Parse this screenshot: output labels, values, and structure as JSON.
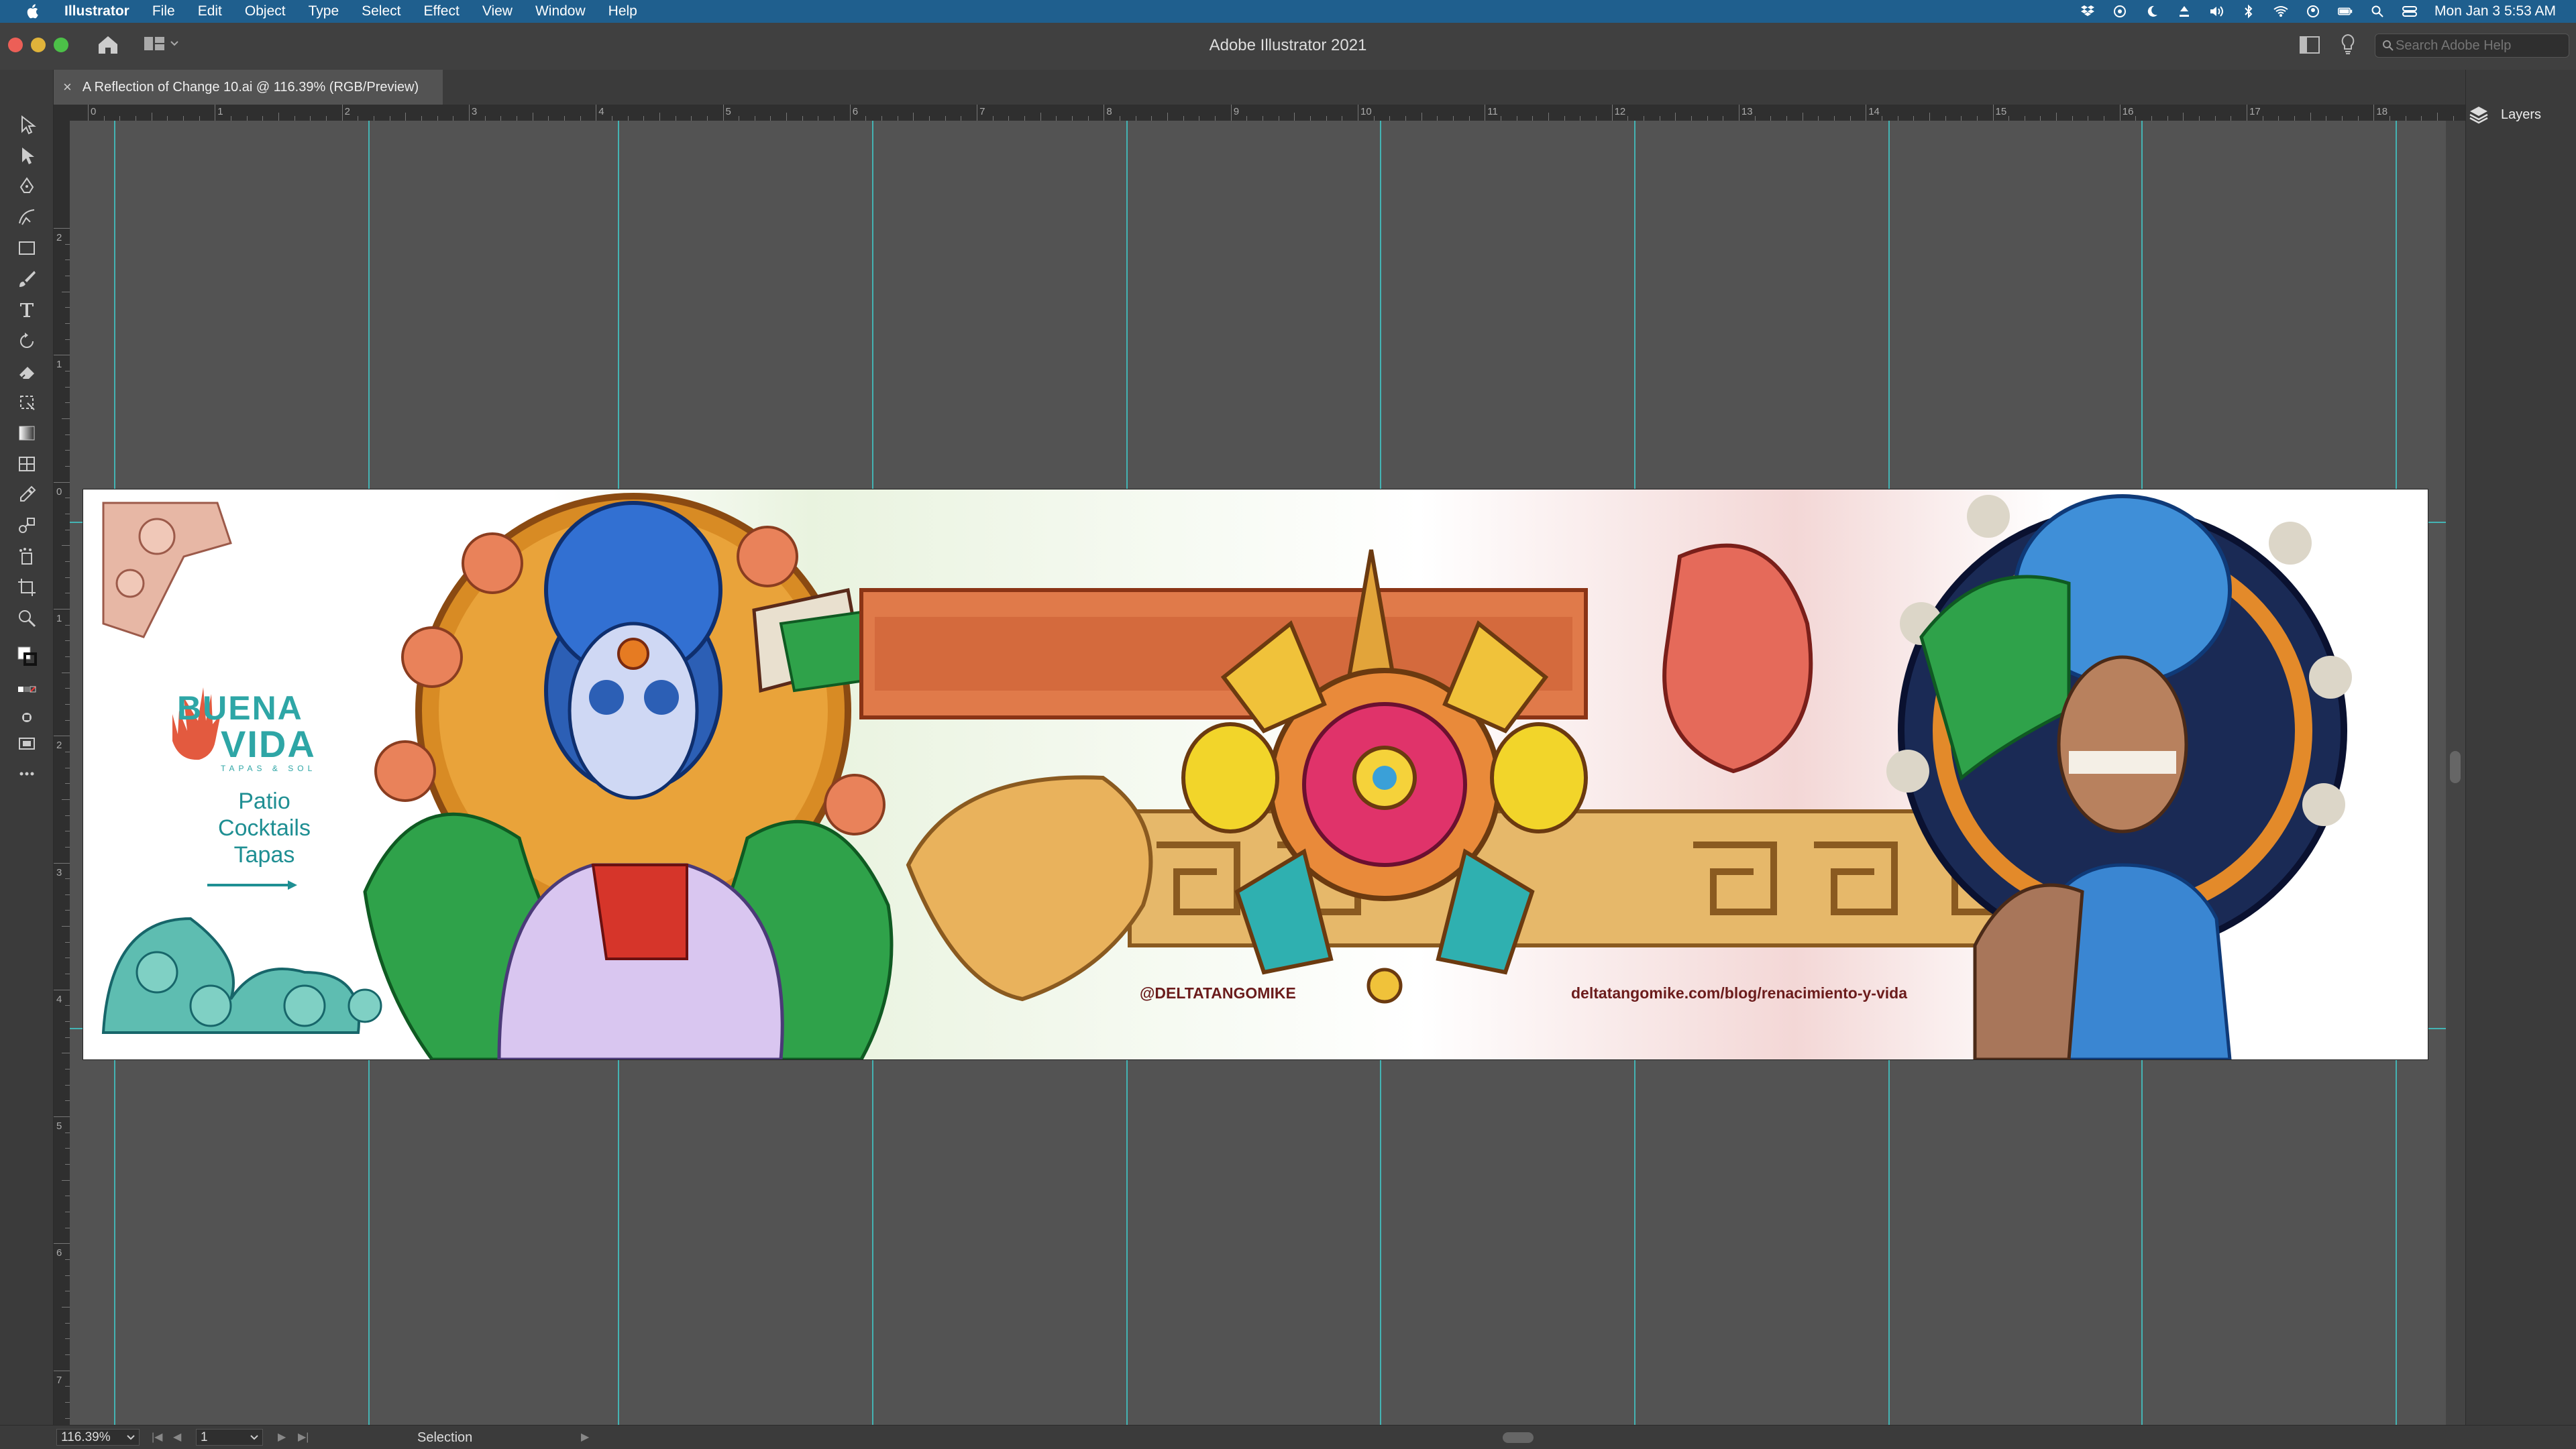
{
  "menubar": {
    "app_name": "Illustrator",
    "menus": [
      "File",
      "Edit",
      "Object",
      "Type",
      "Select",
      "Effect",
      "View",
      "Window",
      "Help"
    ],
    "clock": "Mon Jan 3  5:53 AM"
  },
  "appbar": {
    "title": "Adobe Illustrator 2021",
    "search_placeholder": "Search Adobe Help"
  },
  "document": {
    "tab_title": "A Reflection of Change 10.ai @ 116.39% (RGB/Preview)"
  },
  "ruler": {
    "top_numbers": [
      "0",
      "1",
      "2",
      "3",
      "4",
      "5",
      "6",
      "7",
      "8",
      "9",
      "10",
      "11",
      "12",
      "13",
      "14",
      "15",
      "16",
      "17",
      "18"
    ],
    "left_numbers": [
      "2",
      "1",
      "0",
      "1",
      "2",
      "3",
      "4",
      "5",
      "6",
      "7"
    ]
  },
  "artwork": {
    "logo_line1": "BUENA",
    "logo_line2": "VIDA",
    "logo_tagline": "TAPAS & SOL",
    "promo_lines": [
      "Patio",
      "Cocktails",
      "Tapas"
    ],
    "handle": "@DELTATANGOMIKE",
    "url": "deltatangomike.com/blog/renacimiento-y-vida"
  },
  "panels": {
    "layers_label": "Layers"
  },
  "statusbar": {
    "zoom": "116.39%",
    "artboard_number": "1",
    "current_tool": "Selection"
  },
  "colors": {
    "accent_teal": "#2ea6a6",
    "guide_cyan": "#3fd3d3",
    "text_maroon": "#6b1c1c"
  }
}
